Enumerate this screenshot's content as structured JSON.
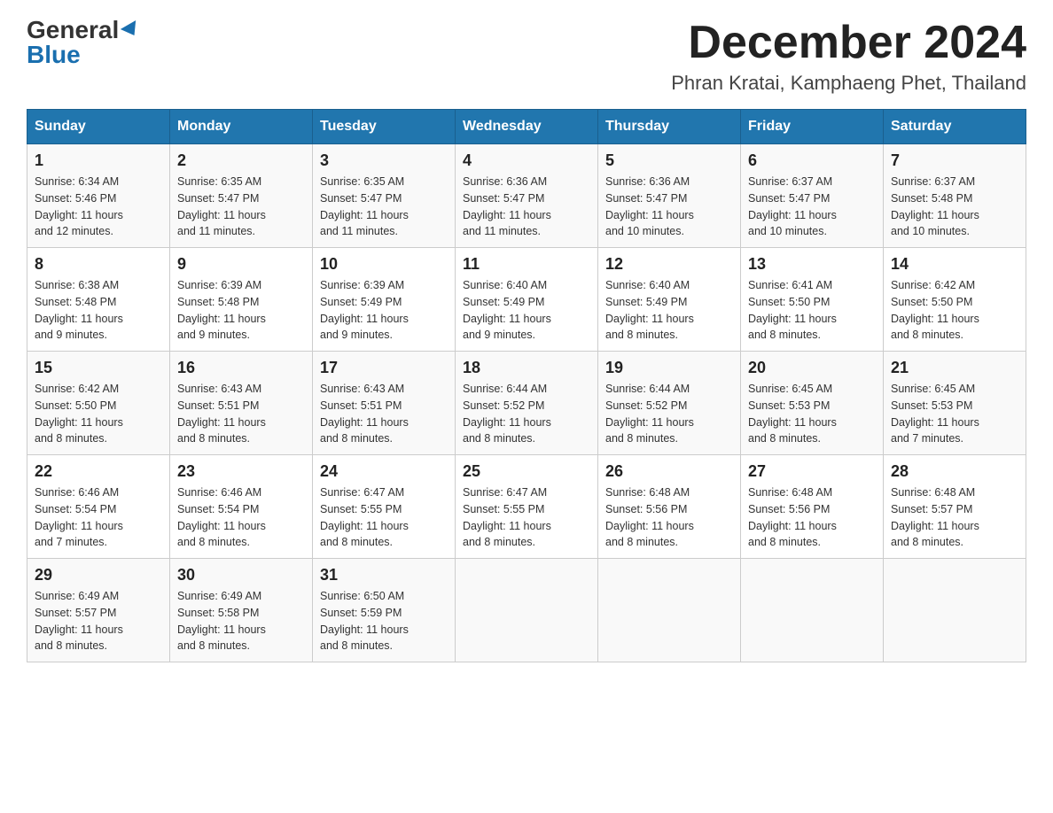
{
  "header": {
    "logo_general": "General",
    "logo_blue": "Blue",
    "month_title": "December 2024",
    "location": "Phran Kratai, Kamphaeng Phet, Thailand"
  },
  "days_of_week": [
    "Sunday",
    "Monday",
    "Tuesday",
    "Wednesday",
    "Thursday",
    "Friday",
    "Saturday"
  ],
  "weeks": [
    [
      {
        "day": "1",
        "sunrise": "6:34 AM",
        "sunset": "5:46 PM",
        "daylight": "11 hours and 12 minutes."
      },
      {
        "day": "2",
        "sunrise": "6:35 AM",
        "sunset": "5:47 PM",
        "daylight": "11 hours and 11 minutes."
      },
      {
        "day": "3",
        "sunrise": "6:35 AM",
        "sunset": "5:47 PM",
        "daylight": "11 hours and 11 minutes."
      },
      {
        "day": "4",
        "sunrise": "6:36 AM",
        "sunset": "5:47 PM",
        "daylight": "11 hours and 11 minutes."
      },
      {
        "day": "5",
        "sunrise": "6:36 AM",
        "sunset": "5:47 PM",
        "daylight": "11 hours and 10 minutes."
      },
      {
        "day": "6",
        "sunrise": "6:37 AM",
        "sunset": "5:47 PM",
        "daylight": "11 hours and 10 minutes."
      },
      {
        "day": "7",
        "sunrise": "6:37 AM",
        "sunset": "5:48 PM",
        "daylight": "11 hours and 10 minutes."
      }
    ],
    [
      {
        "day": "8",
        "sunrise": "6:38 AM",
        "sunset": "5:48 PM",
        "daylight": "11 hours and 9 minutes."
      },
      {
        "day": "9",
        "sunrise": "6:39 AM",
        "sunset": "5:48 PM",
        "daylight": "11 hours and 9 minutes."
      },
      {
        "day": "10",
        "sunrise": "6:39 AM",
        "sunset": "5:49 PM",
        "daylight": "11 hours and 9 minutes."
      },
      {
        "day": "11",
        "sunrise": "6:40 AM",
        "sunset": "5:49 PM",
        "daylight": "11 hours and 9 minutes."
      },
      {
        "day": "12",
        "sunrise": "6:40 AM",
        "sunset": "5:49 PM",
        "daylight": "11 hours and 8 minutes."
      },
      {
        "day": "13",
        "sunrise": "6:41 AM",
        "sunset": "5:50 PM",
        "daylight": "11 hours and 8 minutes."
      },
      {
        "day": "14",
        "sunrise": "6:42 AM",
        "sunset": "5:50 PM",
        "daylight": "11 hours and 8 minutes."
      }
    ],
    [
      {
        "day": "15",
        "sunrise": "6:42 AM",
        "sunset": "5:50 PM",
        "daylight": "11 hours and 8 minutes."
      },
      {
        "day": "16",
        "sunrise": "6:43 AM",
        "sunset": "5:51 PM",
        "daylight": "11 hours and 8 minutes."
      },
      {
        "day": "17",
        "sunrise": "6:43 AM",
        "sunset": "5:51 PM",
        "daylight": "11 hours and 8 minutes."
      },
      {
        "day": "18",
        "sunrise": "6:44 AM",
        "sunset": "5:52 PM",
        "daylight": "11 hours and 8 minutes."
      },
      {
        "day": "19",
        "sunrise": "6:44 AM",
        "sunset": "5:52 PM",
        "daylight": "11 hours and 8 minutes."
      },
      {
        "day": "20",
        "sunrise": "6:45 AM",
        "sunset": "5:53 PM",
        "daylight": "11 hours and 8 minutes."
      },
      {
        "day": "21",
        "sunrise": "6:45 AM",
        "sunset": "5:53 PM",
        "daylight": "11 hours and 7 minutes."
      }
    ],
    [
      {
        "day": "22",
        "sunrise": "6:46 AM",
        "sunset": "5:54 PM",
        "daylight": "11 hours and 7 minutes."
      },
      {
        "day": "23",
        "sunrise": "6:46 AM",
        "sunset": "5:54 PM",
        "daylight": "11 hours and 8 minutes."
      },
      {
        "day": "24",
        "sunrise": "6:47 AM",
        "sunset": "5:55 PM",
        "daylight": "11 hours and 8 minutes."
      },
      {
        "day": "25",
        "sunrise": "6:47 AM",
        "sunset": "5:55 PM",
        "daylight": "11 hours and 8 minutes."
      },
      {
        "day": "26",
        "sunrise": "6:48 AM",
        "sunset": "5:56 PM",
        "daylight": "11 hours and 8 minutes."
      },
      {
        "day": "27",
        "sunrise": "6:48 AM",
        "sunset": "5:56 PM",
        "daylight": "11 hours and 8 minutes."
      },
      {
        "day": "28",
        "sunrise": "6:48 AM",
        "sunset": "5:57 PM",
        "daylight": "11 hours and 8 minutes."
      }
    ],
    [
      {
        "day": "29",
        "sunrise": "6:49 AM",
        "sunset": "5:57 PM",
        "daylight": "11 hours and 8 minutes."
      },
      {
        "day": "30",
        "sunrise": "6:49 AM",
        "sunset": "5:58 PM",
        "daylight": "11 hours and 8 minutes."
      },
      {
        "day": "31",
        "sunrise": "6:50 AM",
        "sunset": "5:59 PM",
        "daylight": "11 hours and 8 minutes."
      },
      null,
      null,
      null,
      null
    ]
  ],
  "labels": {
    "sunrise": "Sunrise:",
    "sunset": "Sunset:",
    "daylight": "Daylight:"
  }
}
